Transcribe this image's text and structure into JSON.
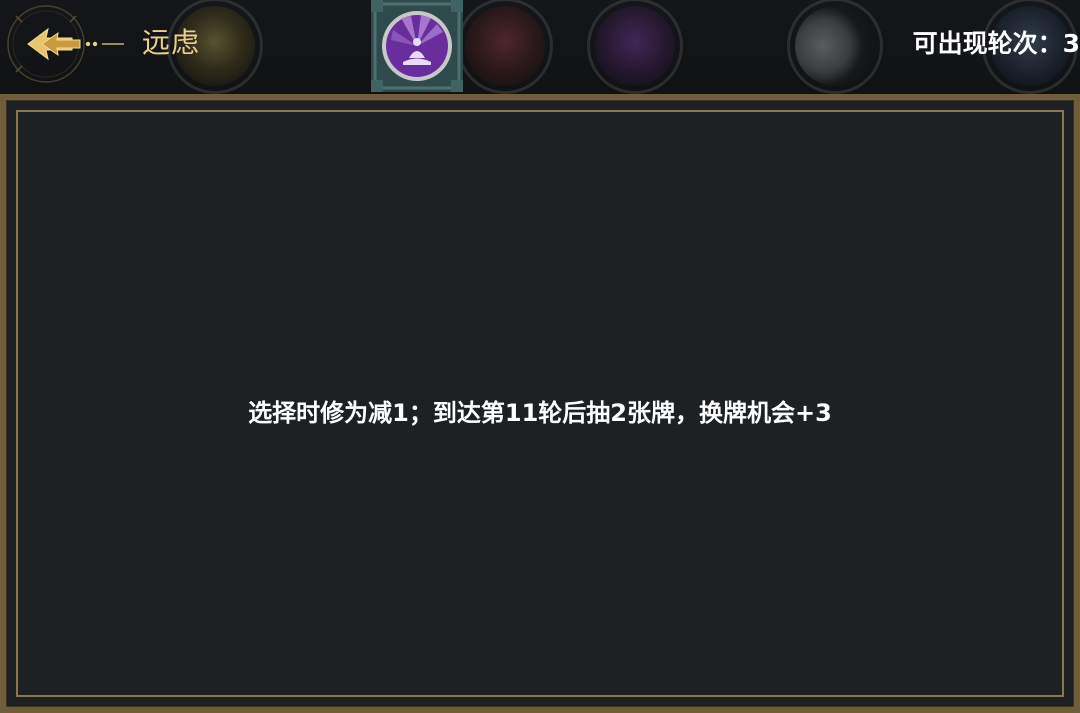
{
  "header": {
    "back_icon": "arrow-back-icon",
    "title": "远虑",
    "rounds_label": "可出现轮次：3",
    "selected_card_icon": "meditation-icon"
  },
  "background_cards": [
    {
      "icon": "faded-card-icon"
    },
    {
      "icon": "faded-card-icon"
    },
    {
      "icon": "faded-card-icon"
    },
    {
      "icon": "yin-yang-icon"
    },
    {
      "icon": "faded-card-icon"
    }
  ],
  "panel": {
    "description": "选择时修为减1；到达第11轮后抽2张牌，换牌机会+3"
  },
  "colors": {
    "gold": "#e8cf8e",
    "panel_bg": "#1c2023",
    "frame": "#6f5d3b",
    "card_purple": "#7b3bb0",
    "card_tile": "#2e4a4a"
  }
}
